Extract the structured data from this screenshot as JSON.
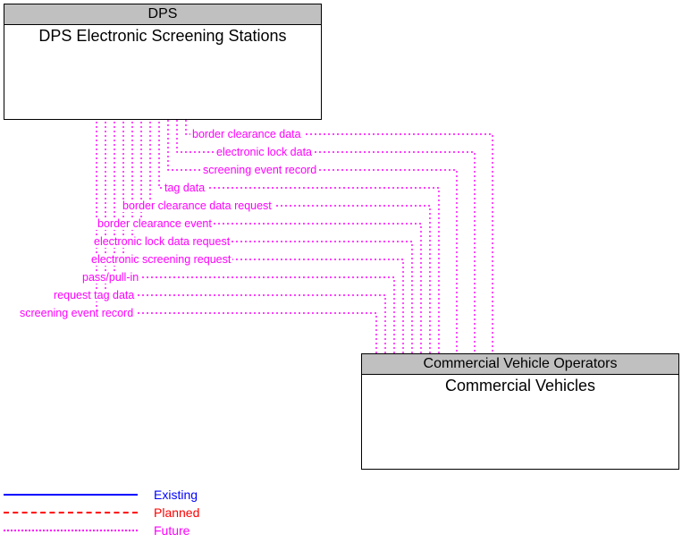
{
  "nodes": {
    "top": {
      "header": "DPS",
      "title": "DPS Electronic Screening Stations"
    },
    "bottom": {
      "header": "Commercial Vehicle Operators",
      "title": "Commercial Vehicles"
    }
  },
  "flows_top_to_bottom": [
    "border clearance data",
    "electronic lock data",
    "screening event record"
  ],
  "flows_bottom_to_top": [
    "tag data",
    "border clearance data request",
    "border clearance event",
    "electronic lock data request",
    "electronic screening request",
    "pass/pull-in",
    "request tag data",
    "screening event record"
  ],
  "legend": {
    "existing": {
      "label": "Existing",
      "color": "#0000ff"
    },
    "planned": {
      "label": "Planned",
      "color": "#ff0000"
    },
    "future": {
      "label": "Future",
      "color": "#ff00ff"
    }
  },
  "colors": {
    "flow": "#ff00ff"
  }
}
